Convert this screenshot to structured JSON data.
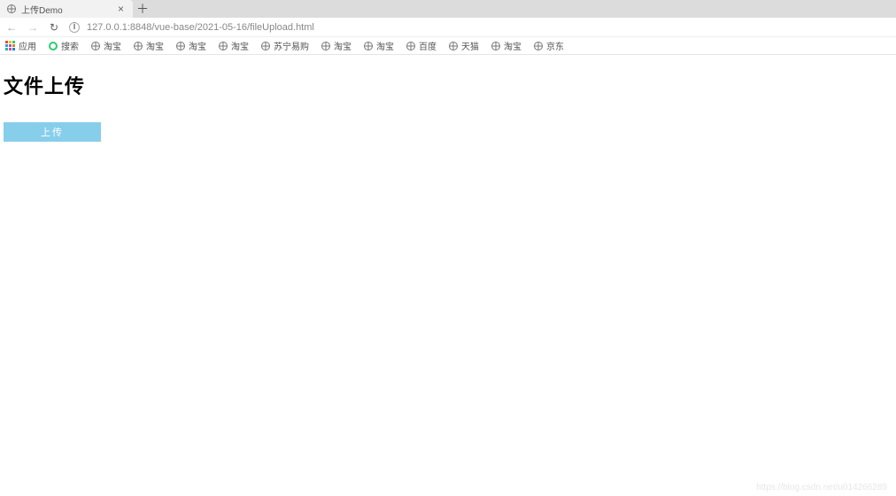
{
  "tab": {
    "title": "上传Demo"
  },
  "address": {
    "url": "127.0.0.1:8848/vue-base/2021-05-16/fileUpload.html"
  },
  "bookmarks": {
    "apps": "应用",
    "items": [
      {
        "label": "搜索",
        "icon": "qihoo"
      },
      {
        "label": "淘宝",
        "icon": "globe"
      },
      {
        "label": "淘宝",
        "icon": "globe"
      },
      {
        "label": "淘宝",
        "icon": "globe"
      },
      {
        "label": "淘宝",
        "icon": "globe"
      },
      {
        "label": "苏宁易购",
        "icon": "globe"
      },
      {
        "label": "淘宝",
        "icon": "globe"
      },
      {
        "label": "淘宝",
        "icon": "globe"
      },
      {
        "label": "百度",
        "icon": "globe"
      },
      {
        "label": "天猫",
        "icon": "globe"
      },
      {
        "label": "淘宝",
        "icon": "globe"
      },
      {
        "label": "京东",
        "icon": "globe"
      }
    ]
  },
  "page": {
    "heading": "文件上传",
    "upload_label": "上传"
  },
  "watermark": "https://blog.csdn.net/u014266289"
}
